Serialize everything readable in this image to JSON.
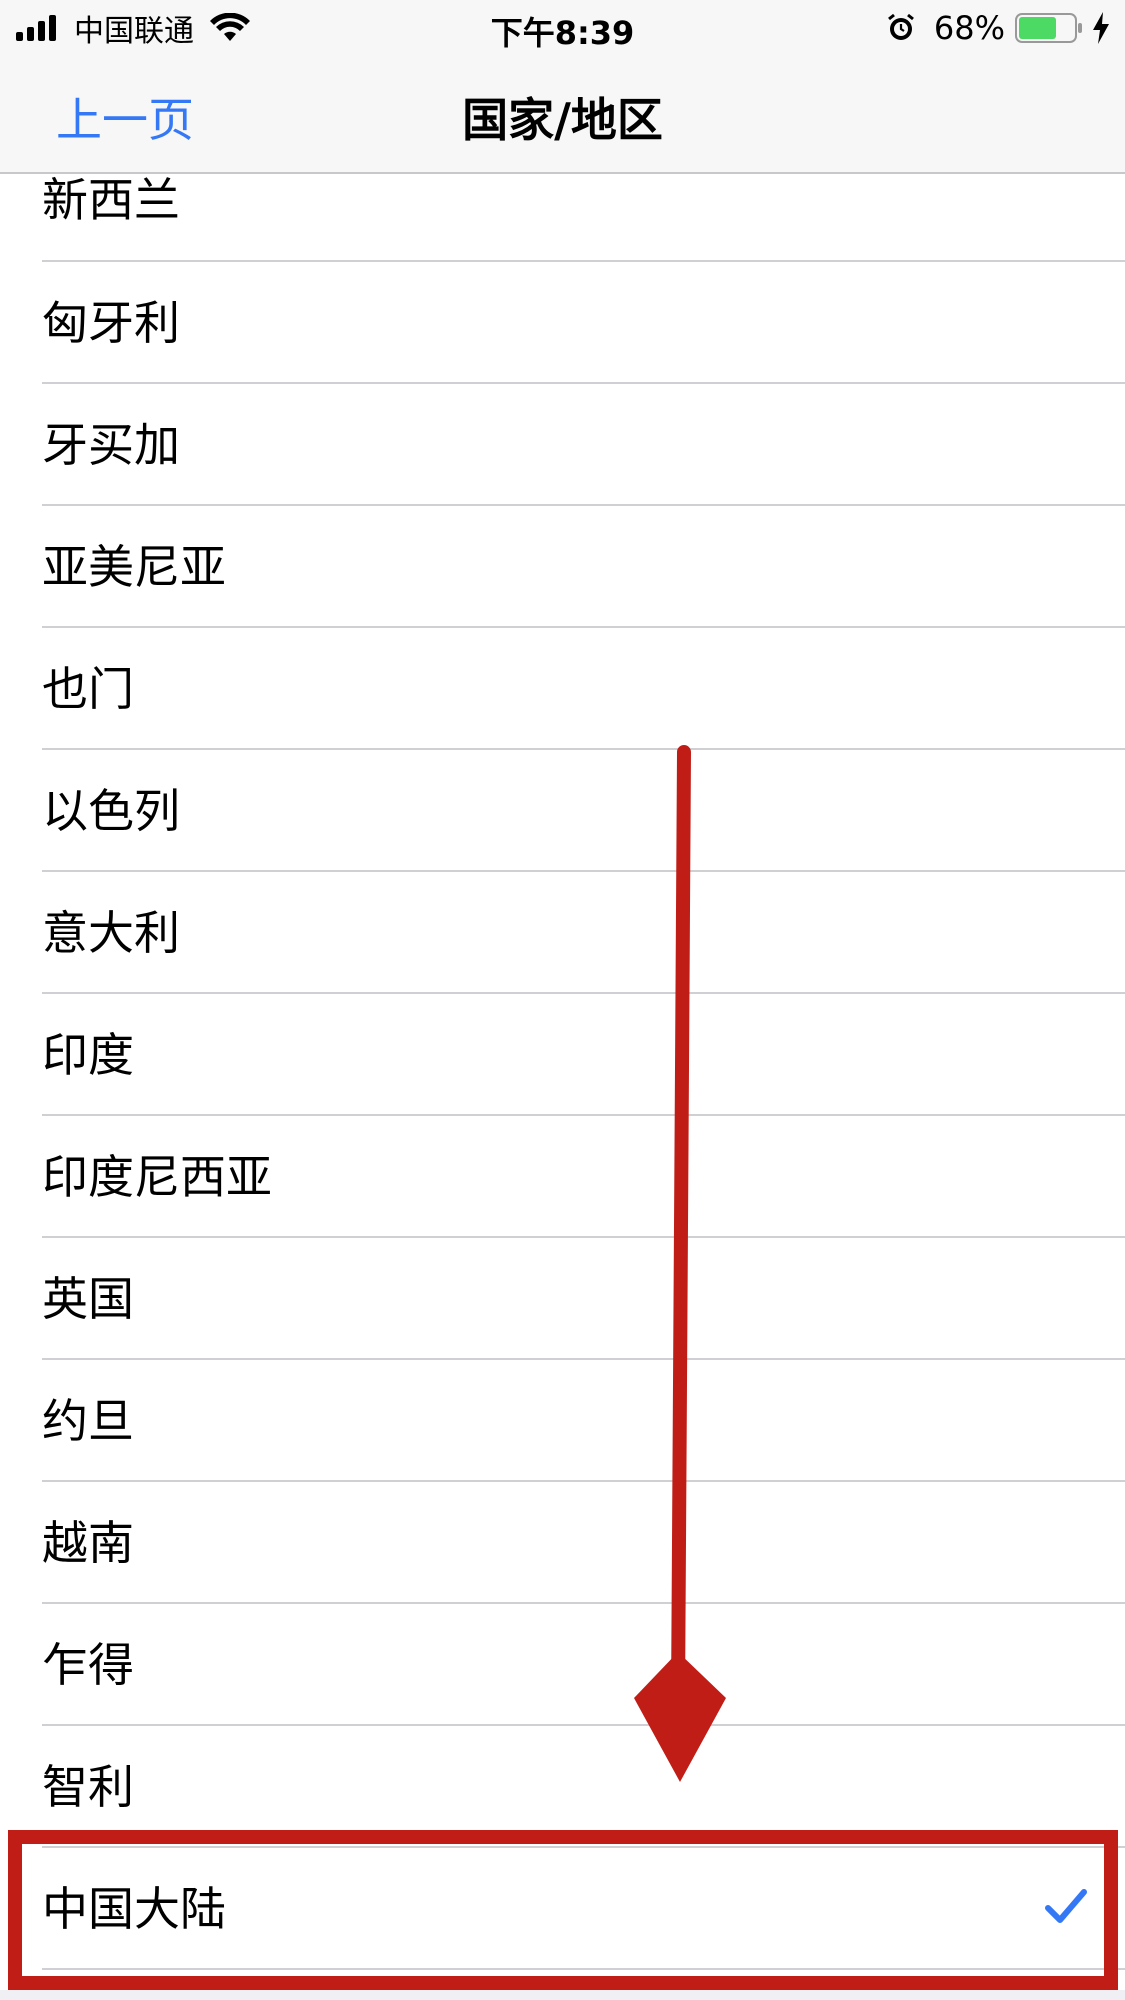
{
  "status_bar": {
    "carrier": "中国联通",
    "time": "下午8:39",
    "battery": "68%",
    "battery_level": 0.68,
    "icons": [
      "signal-icon",
      "wifi-icon",
      "alarm-icon",
      "battery-icon",
      "charging-icon"
    ]
  },
  "nav": {
    "back_label": "上一页",
    "title": "国家/地区"
  },
  "countries": [
    "新西兰",
    "匈牙利",
    "牙买加",
    "亚美尼亚",
    "也门",
    "以色列",
    "意大利",
    "印度",
    "印度尼西亚",
    "英国",
    "约旦",
    "越南",
    "乍得",
    "智利"
  ],
  "selected": {
    "label": "中国大陆",
    "icon": "checkmark-icon"
  },
  "colors": {
    "accent": "#3478f6",
    "annotation": "#c11d17",
    "battery_fill": "#4cd964"
  }
}
